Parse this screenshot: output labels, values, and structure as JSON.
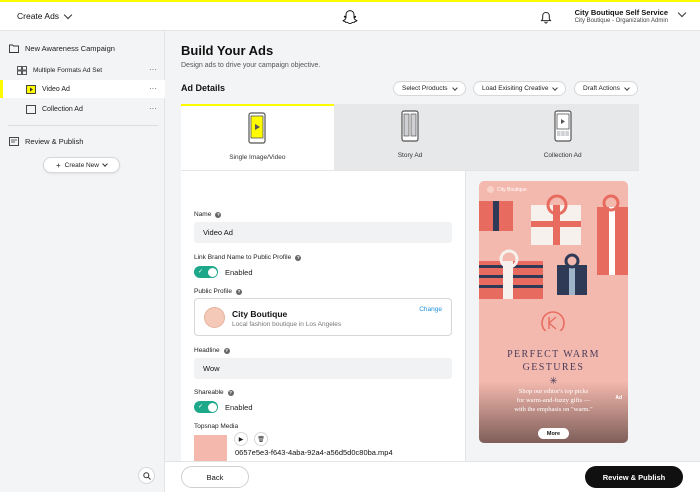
{
  "topbar": {
    "menu_label": "Create Ads",
    "account_name": "City Boutique Self Service",
    "account_sub": "City Boutique - Organization Admin"
  },
  "sidebar": {
    "campaign": "New Awareness Campaign",
    "ad_set": "Multiple Formats Ad Set",
    "items": [
      {
        "label": "Video Ad",
        "active": true
      },
      {
        "label": "Collection Ad",
        "active": false
      }
    ],
    "review": "Review & Publish",
    "create_new": "Create New",
    "dots": "···"
  },
  "main": {
    "title": "Build Your Ads",
    "subtitle": "Design ads to drive your campaign objective.",
    "section": "Ad Details",
    "actions": [
      "Select Products",
      "Load Exisiting Creative",
      "Draft Actions"
    ],
    "tabs": [
      {
        "label": "Single Image/Video",
        "active": true
      },
      {
        "label": "Story Ad",
        "active": false
      },
      {
        "label": "Collection Ad",
        "active": false
      }
    ]
  },
  "form": {
    "name_label": "Name",
    "name_value": "Video Ad",
    "link_label": "Link Brand Name to Public Profile",
    "link_state": "Enabled",
    "profile_label": "Public Profile",
    "profile_name": "City Boutique",
    "profile_desc": "Local fashion boutique in Los Angeles",
    "profile_change": "Change",
    "headline_label": "Headline",
    "headline_value": "Wow",
    "shareable_label": "Shareable",
    "shareable_state": "Enabled",
    "media_label": "Topsnap Media",
    "media_file": "0657e5e3-f643-4aba-92a4-a56d5d0c80ba.mp4",
    "help": "?",
    "play": "▶",
    "delete": "🗑"
  },
  "preview": {
    "brand": "City Boutique",
    "title_line1": "PERFECT WARM",
    "title_line2": "GESTURES",
    "star": "✳",
    "copy_line1": "Shop our editor's top picks",
    "copy_line2": "for warm-and-fuzzy gifts —",
    "copy_line3": "with the emphasis on \"warm.\"",
    "ad_tag": "Ad",
    "more": "More"
  },
  "footer": {
    "back": "Back",
    "publish": "Review & Publish"
  },
  "colors": {
    "brand_yellow": "#fffc00",
    "toggle_green": "#1ea88a",
    "link_blue": "#1d8fd8",
    "publish_black": "#101010",
    "preview_pink": "#f4b9ae"
  },
  "icons": [
    "chevron-down-icon",
    "snapchat-ghost-icon",
    "bell-icon",
    "folder-icon",
    "adset-icon",
    "ad-icon",
    "review-icon",
    "plus-icon",
    "search-icon",
    "phone-single-icon",
    "phone-story-icon",
    "phone-collection-icon",
    "play-icon",
    "trash-icon",
    "check-icon"
  ]
}
